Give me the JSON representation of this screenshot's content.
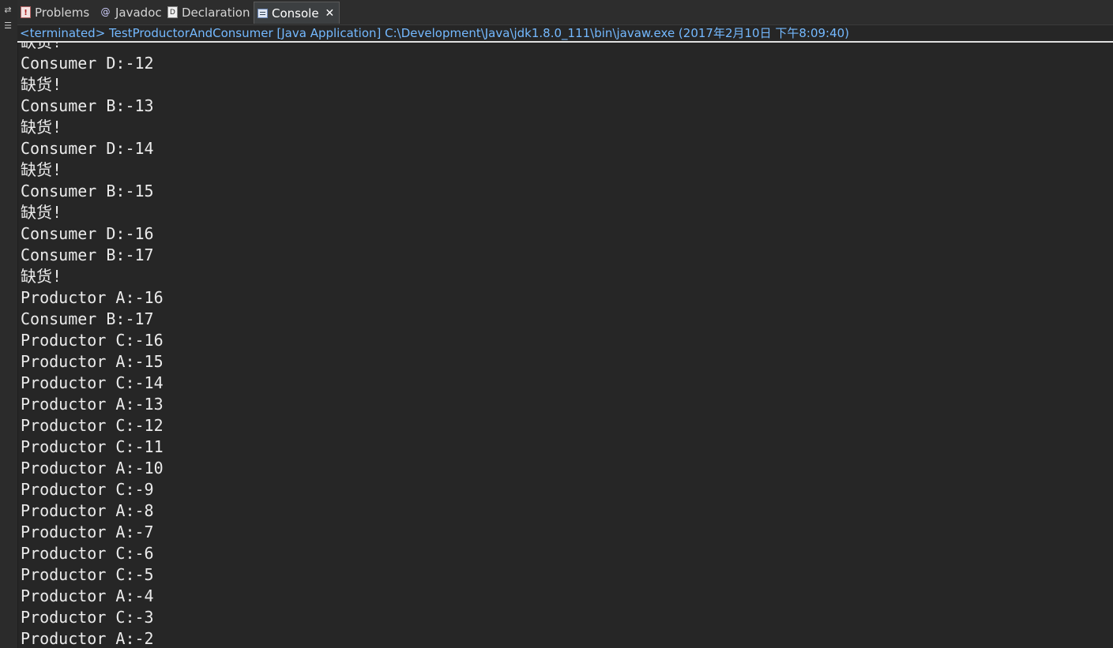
{
  "tabs": [
    {
      "label": "Problems",
      "icon": "problems-icon"
    },
    {
      "label": "Javadoc",
      "icon": "javadoc-icon"
    },
    {
      "label": "Declaration",
      "icon": "declaration-icon"
    },
    {
      "label": "Console",
      "icon": "console-icon",
      "active": true
    }
  ],
  "console": {
    "status": "<terminated> TestProductorAndConsumer [Java Application] C:\\Development\\Java\\jdk1.8.0_111\\bin\\javaw.exe (2017年2月10日 下午8:09:40)",
    "lines": [
      "缺货!",
      "Consumer D:-12",
      "缺货!",
      "Consumer B:-13",
      "缺货!",
      "Consumer D:-14",
      "缺货!",
      "Consumer B:-15",
      "缺货!",
      "Consumer D:-16",
      "Consumer B:-17",
      "缺货!",
      "Productor A:-16",
      "Consumer B:-17",
      "Productor C:-16",
      "Productor A:-15",
      "Productor C:-14",
      "Productor A:-13",
      "Productor C:-12",
      "Productor C:-11",
      "Productor A:-10",
      "Productor C:-9",
      "Productor A:-8",
      "Productor A:-7",
      "Productor C:-6",
      "Productor C:-5",
      "Productor A:-4",
      "Productor C:-3",
      "Productor A:-2"
    ]
  },
  "colors": {
    "background": "#262626",
    "text": "#ebebeb",
    "status_text": "#74b9ff"
  }
}
